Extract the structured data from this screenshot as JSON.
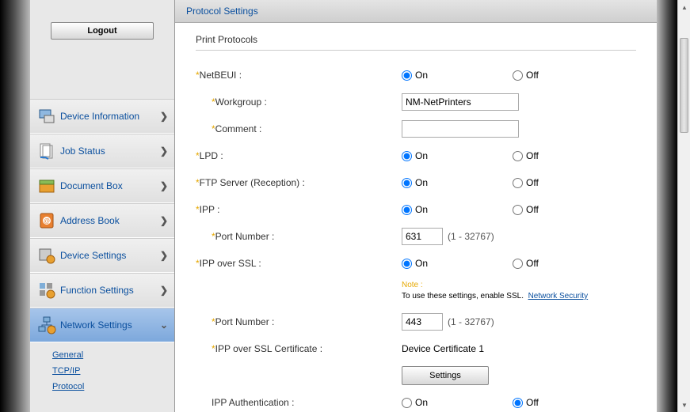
{
  "sidebar": {
    "logout": "Logout",
    "items": [
      {
        "label": "Device Information"
      },
      {
        "label": "Job Status"
      },
      {
        "label": "Document Box"
      },
      {
        "label": "Address Book"
      },
      {
        "label": "Device Settings"
      },
      {
        "label": "Function Settings"
      },
      {
        "label": "Network Settings"
      }
    ],
    "sub": [
      {
        "label": "General"
      },
      {
        "label": "TCP/IP"
      },
      {
        "label": "Protocol"
      }
    ]
  },
  "header": {
    "title": "Protocol Settings"
  },
  "section": {
    "title": "Print Protocols"
  },
  "labels": {
    "netbeui": "NetBEUI :",
    "workgroup": "Workgroup :",
    "comment": "Comment :",
    "lpd": "LPD :",
    "ftp": "FTP Server (Reception) :",
    "ipp": "IPP :",
    "port": "Port Number :",
    "ippssl": "IPP over SSL :",
    "ippsslcert": "IPP over SSL Certificate :",
    "ippauth": "IPP Authentication :",
    "on": "On",
    "off": "Off",
    "portrange": "(1 - 32767)"
  },
  "values": {
    "workgroup": "NM-NetPrinters",
    "comment": "",
    "ipp_port": "631",
    "ippssl_port": "443",
    "ippsslcert": "Device Certificate 1",
    "settings_btn": "Settings"
  },
  "note": {
    "label": "Note :",
    "text": "To use these settings, enable SSL.",
    "link": "Network Security"
  },
  "radios": {
    "netbeui": "on",
    "lpd": "on",
    "ftp": "on",
    "ipp": "on",
    "ippssl": "on",
    "ippauth": "off"
  }
}
